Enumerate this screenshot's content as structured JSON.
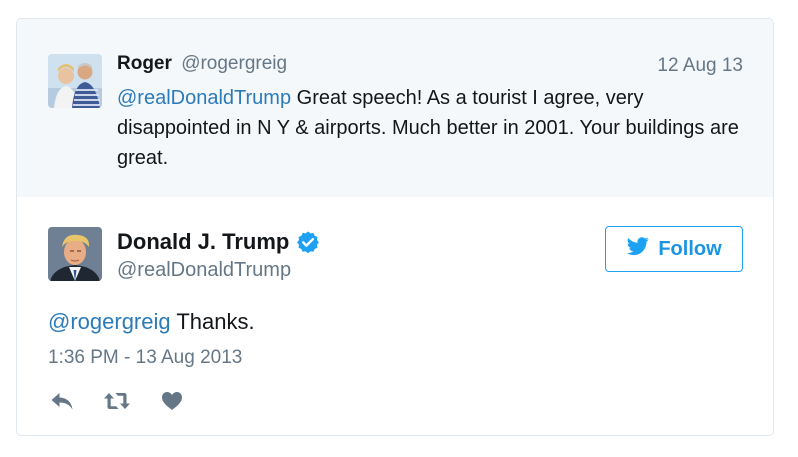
{
  "parent_tweet": {
    "author_name": "Roger",
    "author_handle": "@rogergreig",
    "date": "12 Aug 13",
    "mention": "@realDonaldTrump",
    "text": " Great speech! As a tourist I agree, very disappointed in N Y & airports. Much better in 2001. Your buildings are great.",
    "avatar_icon": "couple-photo-avatar"
  },
  "main_tweet": {
    "author_name": "Donald J. Trump",
    "author_handle": "@realDonaldTrump",
    "verified_icon": "verified-badge-icon",
    "mention": "@rogergreig",
    "text": " Thanks.",
    "timestamp": "1:36 PM - 13 Aug 2013",
    "avatar_icon": "portrait-avatar"
  },
  "follow_button": {
    "label": "Follow",
    "icon": "twitter-bird-icon"
  },
  "actions": [
    {
      "icon": "reply-icon"
    },
    {
      "icon": "retweet-icon"
    },
    {
      "icon": "like-heart-icon"
    }
  ],
  "colors": {
    "link": "#2b7bb9",
    "accent": "#1da1f2",
    "muted": "#657786",
    "text": "#14171a",
    "parent_bg": "#f5f8fa",
    "border": "#e1e8ed"
  }
}
